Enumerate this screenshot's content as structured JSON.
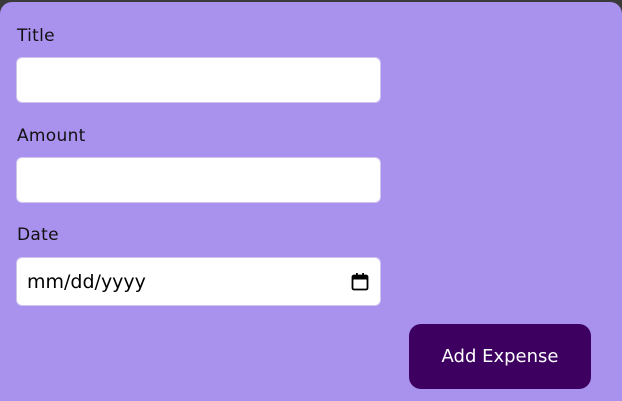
{
  "form": {
    "title_label": "Title",
    "title_value": "",
    "amount_label": "Amount",
    "amount_value": "",
    "date_label": "Date",
    "date_placeholder": "mm/dd/yyyy",
    "submit_label": "Add Expense"
  },
  "colors": {
    "panel_background": "#a991ee",
    "button_background": "#3d0060",
    "button_text": "#ffffff",
    "input_background": "#ffffff"
  },
  "icons": {
    "date_picker": "calendar-icon"
  }
}
